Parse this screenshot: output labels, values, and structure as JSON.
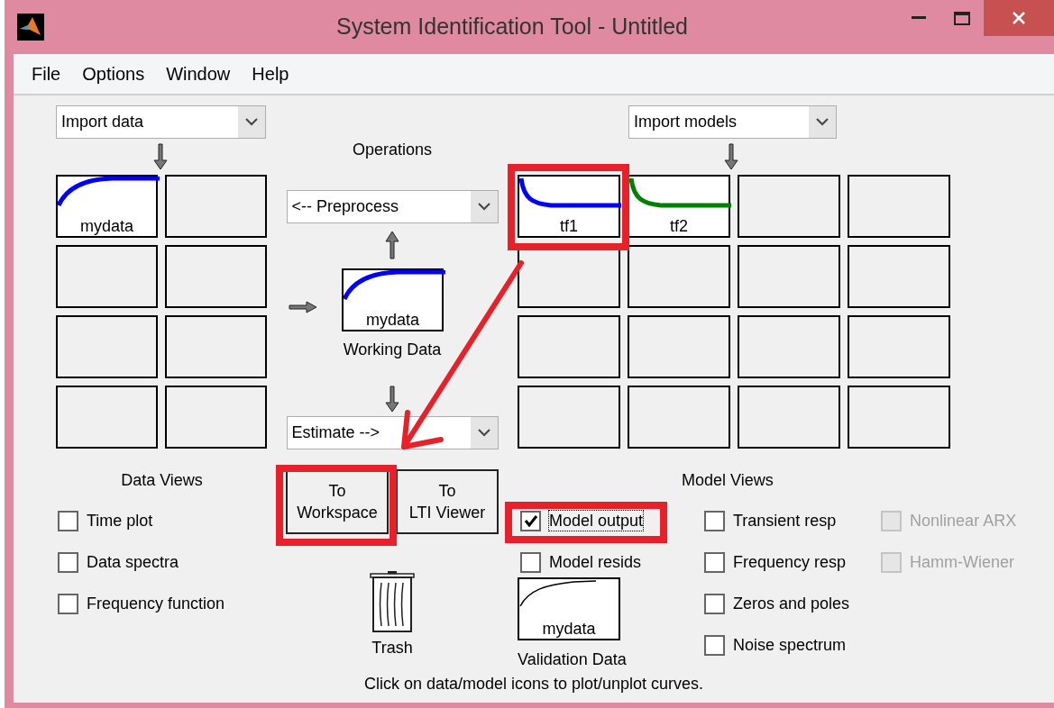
{
  "window": {
    "title": "System Identification Tool - Untitled"
  },
  "menu": [
    "File",
    "Options",
    "Window",
    "Help"
  ],
  "data_panel": {
    "import": "Import data",
    "boards": [
      {
        "kind": "rising",
        "label": "mydata",
        "color": "#0000ff"
      },
      {
        "kind": "empty"
      },
      {
        "kind": "empty"
      },
      {
        "kind": "empty"
      },
      {
        "kind": "empty"
      },
      {
        "kind": "empty"
      },
      {
        "kind": "empty"
      },
      {
        "kind": "empty"
      }
    ]
  },
  "operations": {
    "title": "Operations",
    "preprocess": "<-- Preprocess",
    "working_data": {
      "kind": "rising",
      "label": "mydata",
      "color": "#0000ff"
    },
    "working_label": "Working Data",
    "estimate": "Estimate -->",
    "buttons": [
      [
        "To",
        "Workspace"
      ],
      [
        "To",
        "LTI Viewer"
      ]
    ],
    "trash": "Trash"
  },
  "model_panel": {
    "import": "Import models",
    "boards": [
      {
        "kind": "decaying",
        "label": "tf1",
        "color": "#0000ff"
      },
      {
        "kind": "decaying",
        "label": "tf2",
        "color": "#008000"
      },
      {
        "kind": "empty"
      },
      {
        "kind": "empty"
      },
      {
        "kind": "empty"
      },
      {
        "kind": "empty"
      },
      {
        "kind": "empty"
      },
      {
        "kind": "empty"
      },
      {
        "kind": "empty"
      },
      {
        "kind": "empty"
      },
      {
        "kind": "empty"
      },
      {
        "kind": "empty"
      },
      {
        "kind": "empty"
      },
      {
        "kind": "empty"
      },
      {
        "kind": "empty"
      },
      {
        "kind": "empty"
      }
    ]
  },
  "data_views": {
    "title": "Data Views",
    "options": [
      {
        "label": "Time plot",
        "checked": false,
        "disabled": false,
        "focused": false
      },
      {
        "label": "Data spectra",
        "checked": false,
        "disabled": false,
        "focused": false
      },
      {
        "label": "Frequency function",
        "checked": false,
        "disabled": false,
        "focused": false
      }
    ]
  },
  "validation": {
    "options": [
      {
        "label": "Model output",
        "checked": true,
        "disabled": false,
        "focused": true
      },
      {
        "label": "Model resids",
        "checked": false,
        "disabled": false,
        "focused": false
      }
    ],
    "board": {
      "kind": "thin",
      "label": "mydata",
      "color": "#000000"
    },
    "label": "Validation Data"
  },
  "model_views": {
    "title": "Model Views",
    "options": [
      {
        "label": "Transient resp",
        "checked": false,
        "disabled": false,
        "focused": false
      },
      {
        "label": "Frequency resp",
        "checked": false,
        "disabled": false,
        "focused": false
      },
      {
        "label": "Zeros and poles",
        "checked": false,
        "disabled": false,
        "focused": false
      },
      {
        "label": "Noise spectrum",
        "checked": false,
        "disabled": false,
        "focused": false
      }
    ],
    "extra_options": [
      {
        "label": "Nonlinear ARX",
        "checked": false,
        "disabled": true,
        "focused": false
      },
      {
        "label": "Hamm-Wiener",
        "checked": false,
        "disabled": true,
        "focused": false
      }
    ]
  },
  "hint": "Click on data/model icons to plot/unplot curves."
}
